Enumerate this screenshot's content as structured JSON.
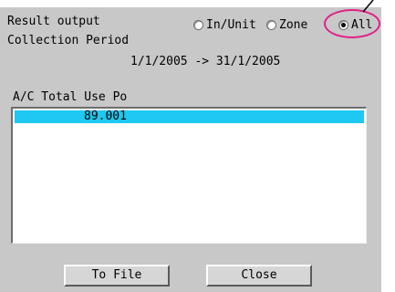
{
  "header": {
    "result_output_label": "Result output",
    "collection_period_label": "Collection Period",
    "collection_period_value": "1/1/2005 -> 31/1/2005"
  },
  "radios": {
    "in_unit": {
      "label": "In/Unit",
      "selected": false
    },
    "zone": {
      "label": "Zone",
      "selected": false
    },
    "all": {
      "label": "All",
      "selected": true
    }
  },
  "list": {
    "header": "A/C Total Use Po",
    "rows": [
      {
        "value": "89.001",
        "selected": true
      }
    ]
  },
  "buttons": {
    "to_file": "To File",
    "close": "Close"
  },
  "colors": {
    "panel_bg": "#c8c8c8",
    "selection": "#1ec8f0",
    "highlight_ring": "#e0208a"
  }
}
